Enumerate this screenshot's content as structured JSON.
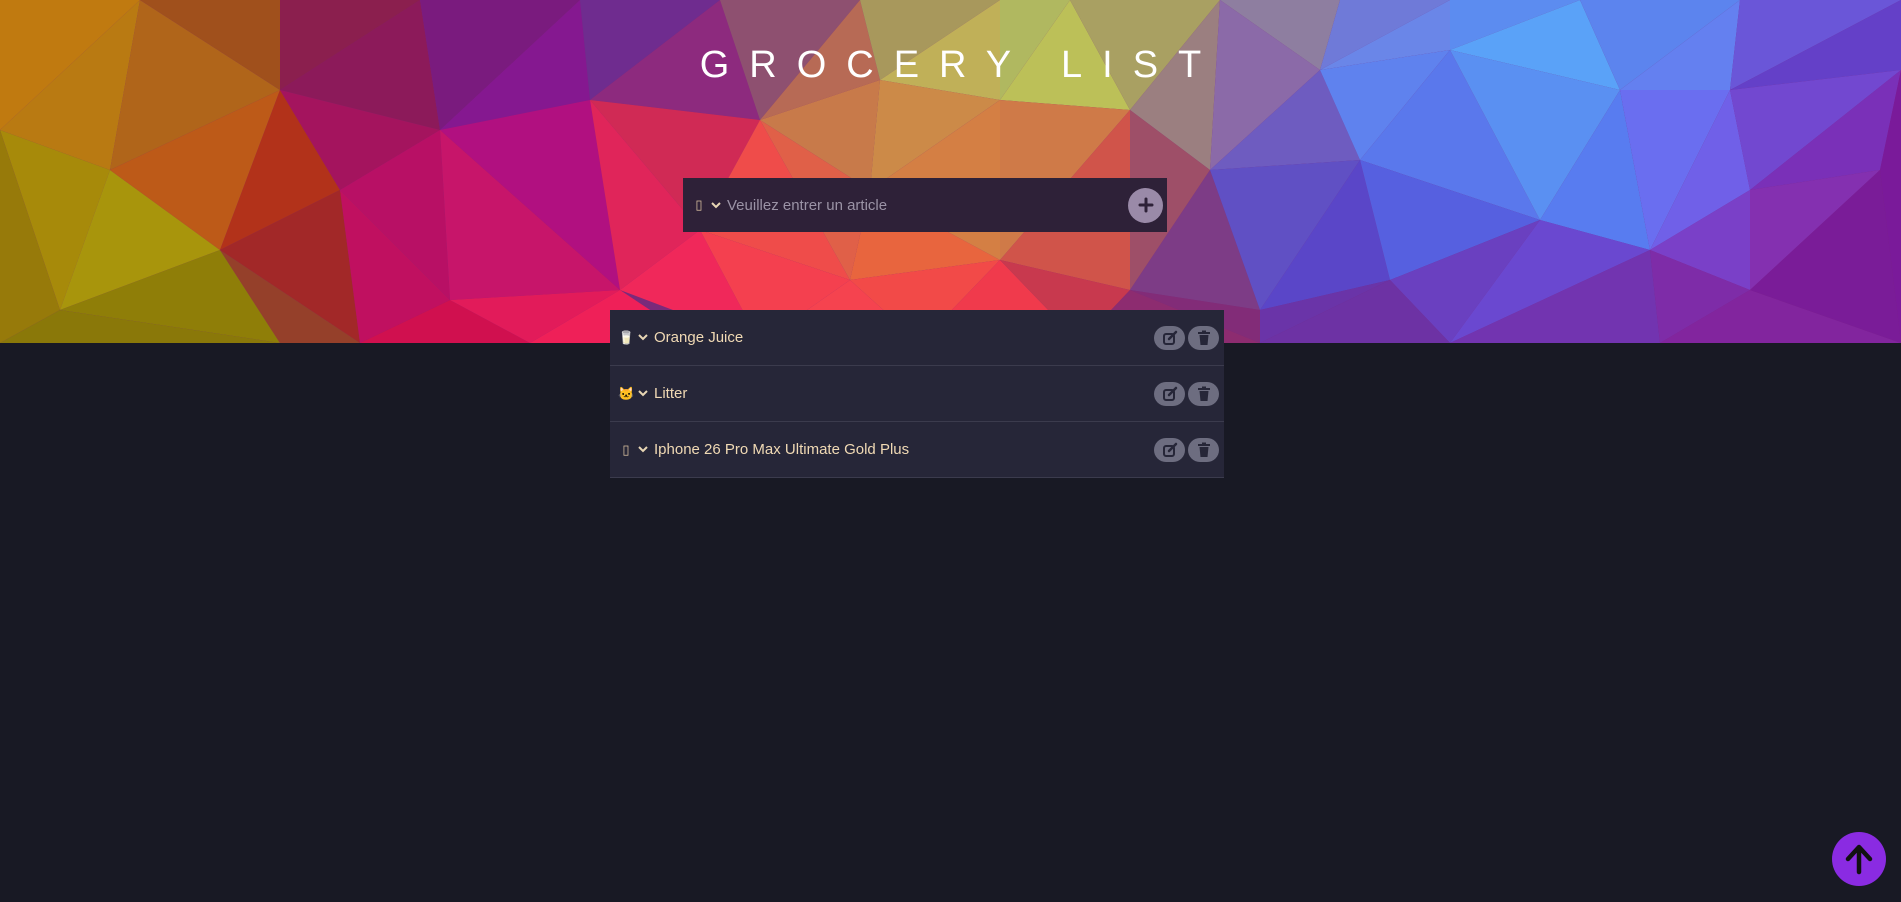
{
  "header": {
    "title": "GROCERY LIST"
  },
  "add_form": {
    "category_icon": "placeholder-emoji-icon",
    "input_placeholder": "Veuillez entrer un article",
    "input_value": "",
    "add_button_icon": "plus-icon"
  },
  "items": [
    {
      "emoji": "🥛",
      "icon_name": "cup-icon",
      "label": "Orange Juice"
    },
    {
      "emoji": "🐱",
      "icon_name": "cat-icon",
      "label": "Litter"
    },
    {
      "emoji": "▯",
      "icon_name": "placeholder-emoji-icon",
      "label": "Iphone 26 Pro Max Ultimate Gold Plus"
    }
  ],
  "colors": {
    "background": "#181924",
    "accent": "#8a2be2",
    "item_text": "#f0d9b4"
  }
}
